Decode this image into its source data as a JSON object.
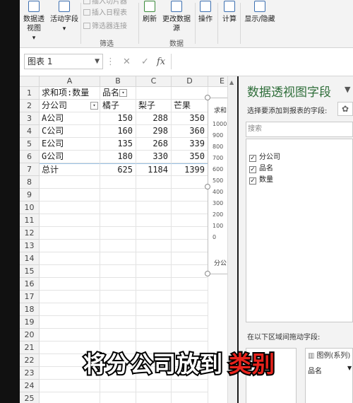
{
  "ribbon": {
    "btn_pivot": "数据透视图",
    "btn_pivot_dd": "▾",
    "btn_active_field": "活动字段",
    "btn_active_field_dd": "▾",
    "small_insert_slicer": "插入切片器",
    "small_insert_timeline": "插入日程表",
    "small_filter_conn": "筛选器连接",
    "group_filter": "筛选",
    "btn_refresh": "刷新",
    "btn_change_source": "更改数据源",
    "group_data": "数据",
    "btn_actions": "操作",
    "btn_calc": "计算",
    "btn_show_hide": "显示/隐藏"
  },
  "formula_bar": {
    "name_box": "图表 1",
    "cancel": "✕",
    "enter": "✓",
    "fx": "fx",
    "value": ""
  },
  "sheet": {
    "columns": [
      "A",
      "B",
      "C",
      "D",
      "E"
    ],
    "rows": [
      "1",
      "2",
      "3",
      "4",
      "5",
      "6",
      "7",
      "8",
      "9",
      "10",
      "11",
      "12",
      "13",
      "14",
      "15",
      "16",
      "17",
      "18",
      "19",
      "20",
      "21",
      "22",
      "23",
      "24",
      "25"
    ],
    "r1": {
      "a": "求和项:数量",
      "b": "品名"
    },
    "r2": {
      "a": "分公司",
      "b": "橘子",
      "c": "梨子",
      "d": "芒果"
    },
    "data": [
      {
        "a": "A公司",
        "b": "150",
        "c": "288",
        "d": "350"
      },
      {
        "a": "C公司",
        "b": "160",
        "c": "298",
        "d": "360"
      },
      {
        "a": "E公司",
        "b": "135",
        "c": "268",
        "d": "339"
      },
      {
        "a": "G公司",
        "b": "180",
        "c": "330",
        "d": "350"
      },
      {
        "a": "总计",
        "b": "625",
        "c": "1184",
        "d": "1399"
      }
    ]
  },
  "chart": {
    "title_partial": "求和",
    "ticks": [
      "1000",
      "900",
      "800",
      "700",
      "600",
      "500",
      "400",
      "300",
      "200",
      "100",
      "0"
    ],
    "axis_partial": "分公"
  },
  "pane": {
    "title": "数据透视图字段",
    "subtitle": "选择要添加到报表的字段:",
    "search_placeholder": "搜索",
    "fields": [
      {
        "label": "分公司",
        "checked": true
      },
      {
        "label": "品名",
        "checked": true
      },
      {
        "label": "数量",
        "checked": true
      }
    ],
    "drag_label": "在以下区域间拖动字段:",
    "legend_area_title": "图例(系列)",
    "legend_item": "品名"
  },
  "caption": {
    "part1": "将分公司放到",
    "part2": "类别"
  }
}
